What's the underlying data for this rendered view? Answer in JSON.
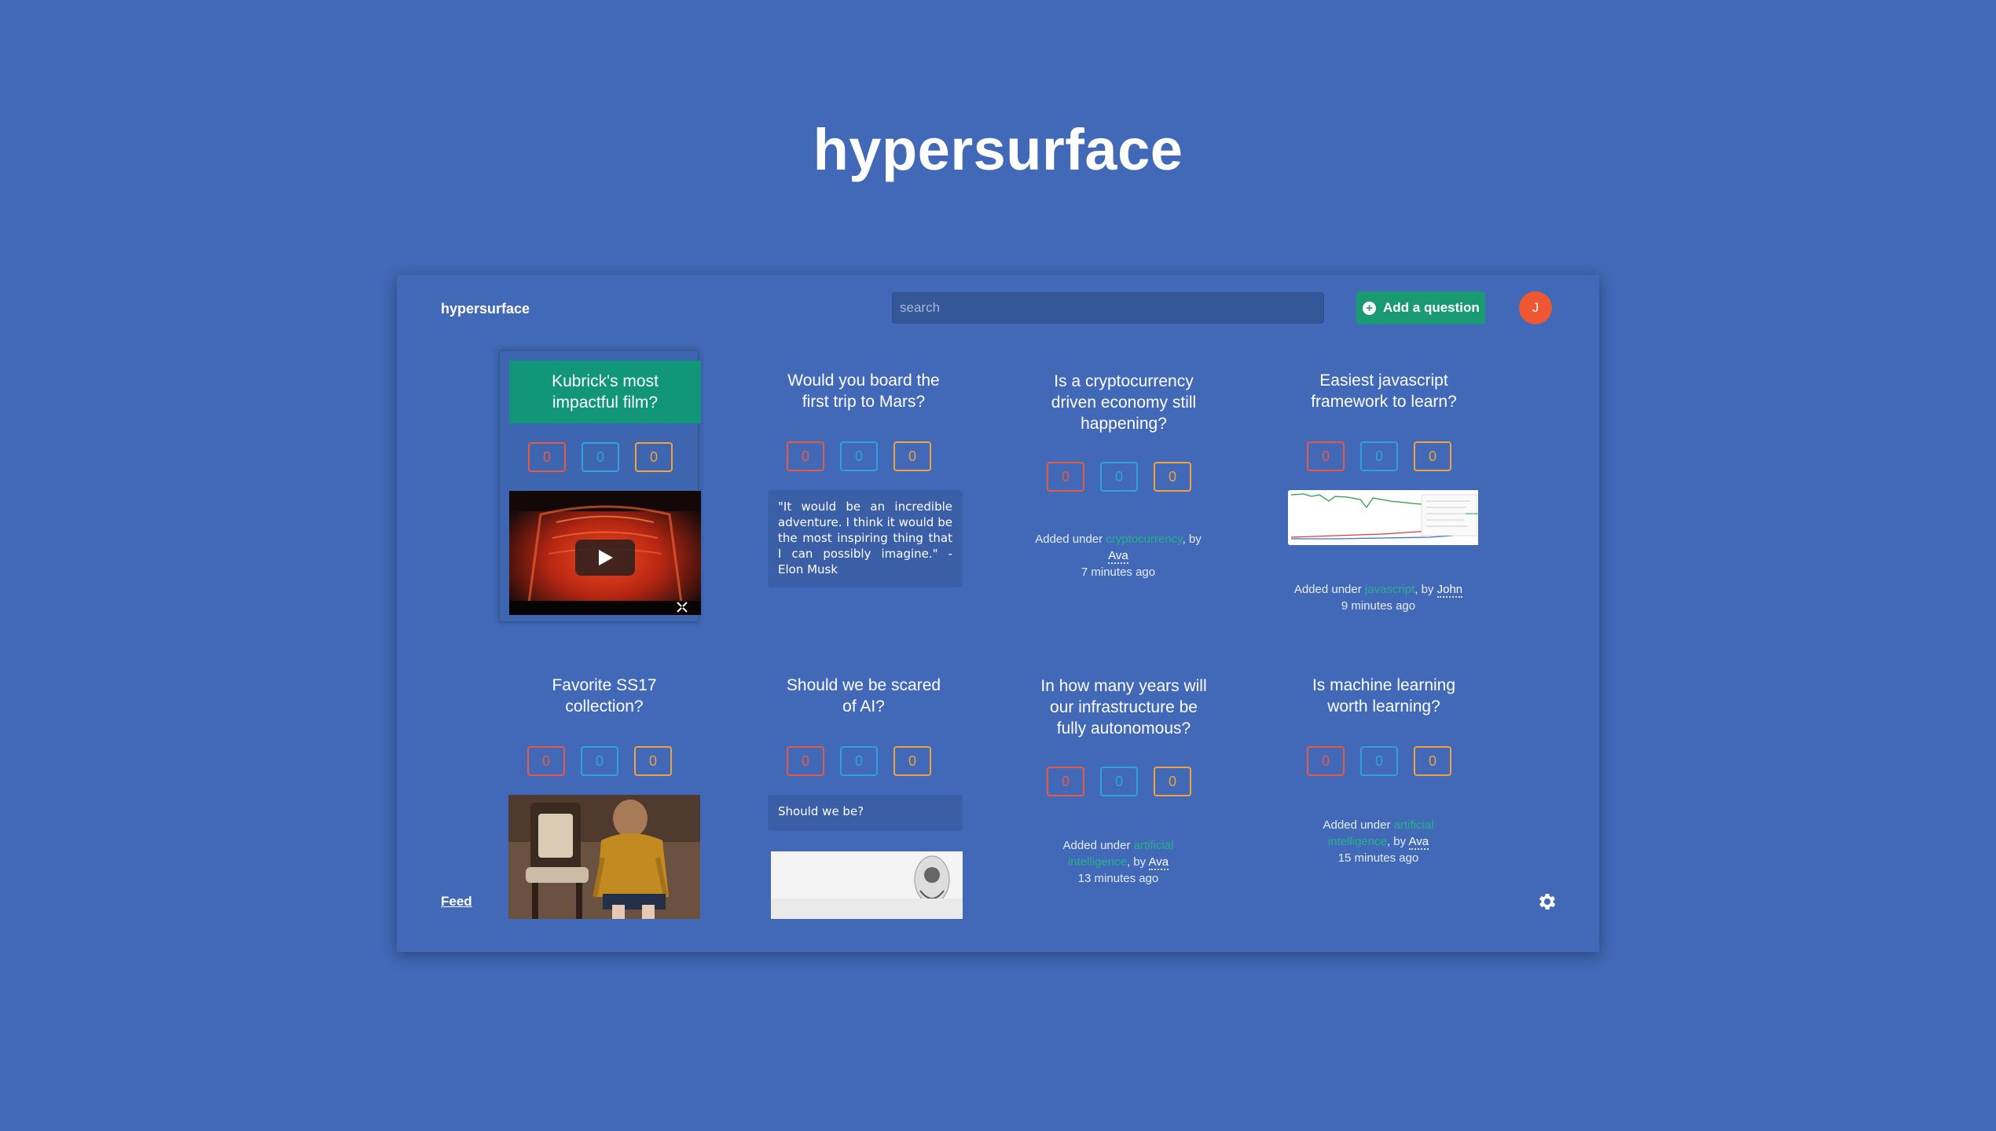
{
  "hero": {
    "title": "hypersurface"
  },
  "header": {
    "brand": "hypersurface",
    "search_placeholder": "search",
    "add_button": "Add a question",
    "avatar_initial": "J"
  },
  "footer": {
    "feed_label": "Feed"
  },
  "colors": {
    "background": "#4169b7",
    "accent_green": "#1a9a73",
    "avatar": "#ef5733",
    "vote_red": "#e55a45",
    "vote_blue": "#2ea2e0",
    "vote_orange": "#f0a23e"
  },
  "cards": [
    {
      "title": "Kubrick's most impactful film?",
      "votes": [
        "0",
        "0",
        "0"
      ],
      "media": "video"
    },
    {
      "title": "Would you board the first trip to Mars?",
      "votes": [
        "0",
        "0",
        "0"
      ],
      "quote": "\"It would be an incredible adventure. I think it would be the most inspiring thing that I can possibly imagine.\" - Elon Musk"
    },
    {
      "title": "Is a cryptocurrency driven economy still happening?",
      "votes": [
        "0",
        "0",
        "0"
      ],
      "meta_prefix": "Added under ",
      "tag": "cryptocurrency",
      "by": ", by",
      "user": "Ava",
      "time": "7 minutes ago"
    },
    {
      "title": "Easiest javascript framework to learn?",
      "votes": [
        "0",
        "0",
        "0"
      ],
      "media": "chart",
      "meta_prefix": "Added under ",
      "tag": "javascript",
      "by": ", by ",
      "user": "John",
      "time": "9 minutes ago"
    },
    {
      "title": "Favorite SS17 collection?",
      "votes": [
        "0",
        "0",
        "0"
      ],
      "media": "photo"
    },
    {
      "title": "Should we be scared of AI?",
      "votes": [
        "0",
        "0",
        "0"
      ],
      "quote": "Should we be?"
    },
    {
      "title": "In how many years will our infrastructure be fully autonomous?",
      "votes": [
        "0",
        "0",
        "0"
      ],
      "meta_prefix": "Added under ",
      "tag": "artificial intelligence",
      "by": ", by ",
      "user": "Ava",
      "time": "13 minutes ago"
    },
    {
      "title": "Is machine learning worth learning?",
      "votes": [
        "0",
        "0",
        "0"
      ],
      "meta_prefix": "Added under ",
      "tag": "artificial intelligence",
      "by": ", by ",
      "user": "Ava",
      "time": "15 minutes ago"
    }
  ]
}
